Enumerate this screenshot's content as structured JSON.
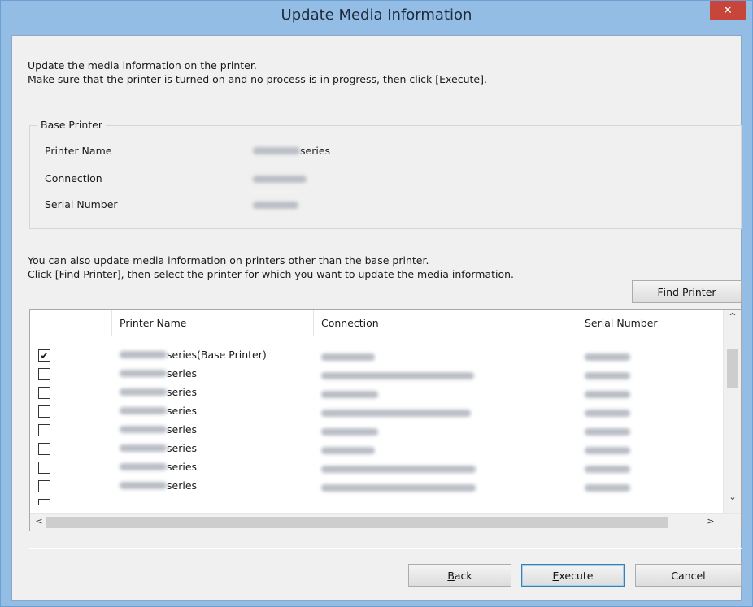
{
  "window": {
    "title": "Update Media Information",
    "close_label": "✕"
  },
  "intro": {
    "line1": "Update the media information on the printer.",
    "line2": "Make sure that the printer is turned on and no process is in progress, then click [Execute]."
  },
  "base_printer": {
    "legend": "Base Printer",
    "printer_name_label": "Printer Name",
    "printer_name_suffix": "series",
    "connection_label": "Connection",
    "serial_number_label": "Serial Number"
  },
  "other_printers": {
    "line1": "You can also update media information on printers other than the base printer.",
    "line2": "Click [Find Printer], then select the printer for which you want to update the media information."
  },
  "find_printer_button": {
    "pre": "",
    "accel": "F",
    "post": "ind Printer"
  },
  "list": {
    "columns": [
      "Printer Name",
      "Connection",
      "Serial Number"
    ],
    "rows": [
      {
        "checked": true,
        "name_suffix": "series(Base Printer)"
      },
      {
        "checked": false,
        "name_suffix": "series"
      },
      {
        "checked": false,
        "name_suffix": "series"
      },
      {
        "checked": false,
        "name_suffix": "series"
      },
      {
        "checked": false,
        "name_suffix": "series"
      },
      {
        "checked": false,
        "name_suffix": "series"
      },
      {
        "checked": false,
        "name_suffix": "series"
      },
      {
        "checked": false,
        "name_suffix": "series"
      }
    ],
    "check_glyph": "✔"
  },
  "buttons": {
    "back": {
      "accel": "B",
      "post": "ack"
    },
    "execute": {
      "accel": "E",
      "post": "xecute"
    },
    "cancel": "Cancel"
  },
  "scroll": {
    "up": "^",
    "down": "⌄",
    "left": "<",
    "right": ">"
  }
}
